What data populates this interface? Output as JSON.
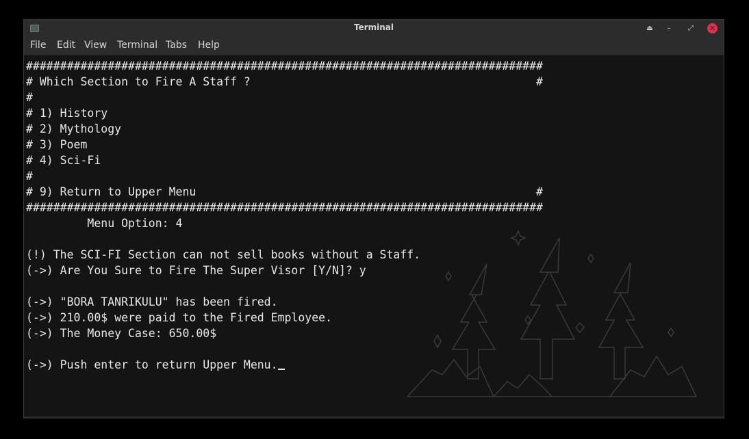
{
  "window": {
    "title": "Terminal",
    "controls": {
      "eject": "⏏",
      "minimize": "–",
      "maximize": "⤢",
      "close": "✕"
    }
  },
  "menubar": {
    "items": [
      "File",
      "Edit",
      "View",
      "Terminal",
      "Tabs",
      "Help"
    ]
  },
  "terminal": {
    "lines": [
      "############################################################################",
      "# Which Section to Fire A Staff ?                                          #",
      "#",
      "# 1) History",
      "# 2) Mythology",
      "# 3) Poem",
      "# 4) Sci-Fi",
      "#",
      "# 9) Return to Upper Menu                                                  #",
      "############################################################################",
      "         Menu Option: 4",
      "",
      "(!) The SCI-FI Section can not sell books without a Staff.",
      "(->) Are You Sure to Fire The Super Visor [Y/N]? y",
      "",
      "(->) \"BORA TANRIKULU\" has been fired.",
      "(->) 210.00$ were paid to the Fired Employee.",
      "(->) The Money Case: 650.00$",
      "",
      "(->) Push enter to return Upper Menu."
    ]
  },
  "colors": {
    "background": "#141414",
    "chrome": "#2c2c2c",
    "text": "#e8e8e8",
    "close": "#e0304a",
    "wallpaper_lines": "#3a3a3a"
  },
  "icons": {
    "app": "terminal-icon",
    "wallpaper": "forest-outline"
  }
}
